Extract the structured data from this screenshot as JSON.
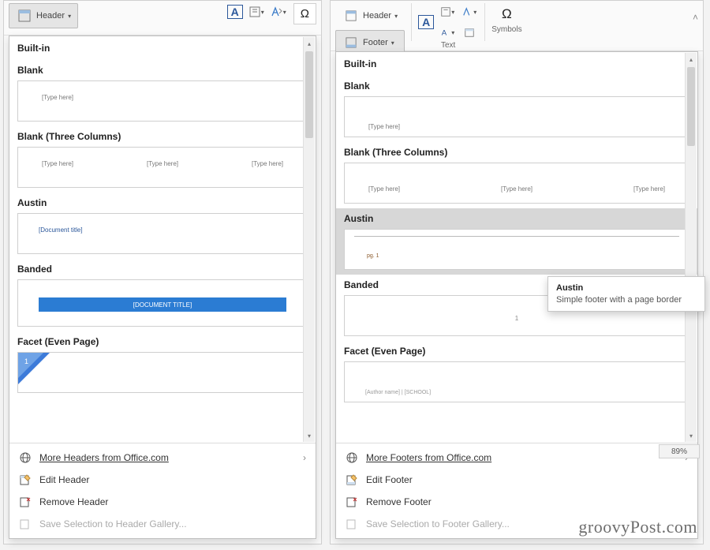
{
  "left": {
    "ribbon": {
      "header_btn": "Header"
    },
    "section": "Built-in",
    "items": {
      "blank": {
        "title": "Blank",
        "ph": "[Type here]"
      },
      "threecol": {
        "title": "Blank (Three Columns)",
        "ph1": "[Type here]",
        "ph2": "[Type here]",
        "ph3": "[Type here]"
      },
      "austin": {
        "title": "Austin",
        "ph": "[Document title]"
      },
      "banded": {
        "title": "Banded",
        "ph": "[DOCUMENT TITLE]"
      },
      "facet": {
        "title": "Facet (Even Page)",
        "num": "1"
      }
    },
    "menu": {
      "more": "More Headers from Office.com",
      "edit": "Edit Header",
      "remove": "Remove Header",
      "save": "Save Selection to Header Gallery..."
    }
  },
  "right": {
    "ribbon": {
      "header_btn": "Header",
      "footer_btn": "Footer",
      "text_label": "Text",
      "symbols_label": "Symbols"
    },
    "section": "Built-in",
    "items": {
      "blank": {
        "title": "Blank",
        "ph": "[Type here]"
      },
      "threecol": {
        "title": "Blank (Three Columns)",
        "ph1": "[Type here]",
        "ph2": "[Type here]",
        "ph3": "[Type here]"
      },
      "austin": {
        "title": "Austin",
        "pg": "pg. 1"
      },
      "banded": {
        "title": "Banded",
        "num": "1"
      },
      "facet": {
        "title": "Facet (Even Page)",
        "ph": "[Author name] | [SCHOOL]"
      }
    },
    "menu": {
      "more": "More Footers from Office.com",
      "edit": "Edit Footer",
      "remove": "Remove Footer",
      "save": "Save Selection to Footer Gallery..."
    },
    "tooltip": {
      "title": "Austin",
      "desc": "Simple footer with a page border"
    },
    "zoom": "89%"
  },
  "brand": "groovyPost.com"
}
